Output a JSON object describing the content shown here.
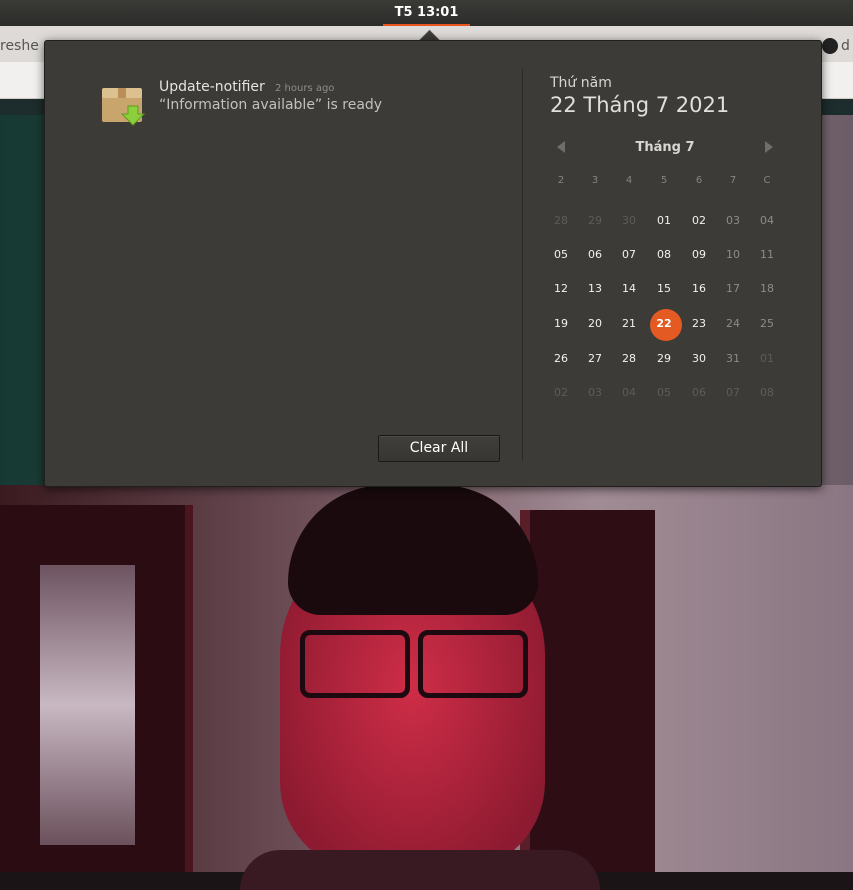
{
  "topbar": {
    "clock": "T5 13:01"
  },
  "browser": {
    "left_tab_text": "reshe",
    "right_tab_text": "d"
  },
  "notifications": [
    {
      "app": "Update-notifier",
      "time": "2 hours ago",
      "body": "“Information available” is ready",
      "icon": "package-download-icon"
    }
  ],
  "clear_all_label": "Clear All",
  "calendar": {
    "weekday": "Thứ năm",
    "full_date": "22 Tháng 7 2021",
    "month_label": "Tháng 7",
    "weekday_headers": [
      "2",
      "3",
      "4",
      "5",
      "6",
      "7",
      "C"
    ],
    "today": "22",
    "accent_color": "#e35a22",
    "weeks": [
      [
        [
          "28",
          "out"
        ],
        [
          "29",
          "out"
        ],
        [
          "30",
          "out"
        ],
        [
          "01",
          "in"
        ],
        [
          "02",
          "in"
        ],
        [
          "03",
          "weekend"
        ],
        [
          "04",
          "weekend"
        ]
      ],
      [
        [
          "05",
          "in"
        ],
        [
          "06",
          "in"
        ],
        [
          "07",
          "in"
        ],
        [
          "08",
          "in"
        ],
        [
          "09",
          "in"
        ],
        [
          "10",
          "weekend"
        ],
        [
          "11",
          "weekend"
        ]
      ],
      [
        [
          "12",
          "in"
        ],
        [
          "13",
          "in"
        ],
        [
          "14",
          "in"
        ],
        [
          "15",
          "in"
        ],
        [
          "16",
          "in"
        ],
        [
          "17",
          "weekend"
        ],
        [
          "18",
          "weekend"
        ]
      ],
      [
        [
          "19",
          "in"
        ],
        [
          "20",
          "in"
        ],
        [
          "21",
          "in"
        ],
        [
          "22",
          "today"
        ],
        [
          "23",
          "in"
        ],
        [
          "24",
          "weekend"
        ],
        [
          "25",
          "weekend"
        ]
      ],
      [
        [
          "26",
          "in"
        ],
        [
          "27",
          "in"
        ],
        [
          "28",
          "in"
        ],
        [
          "29",
          "in"
        ],
        [
          "30",
          "in"
        ],
        [
          "31",
          "weekend"
        ],
        [
          "01",
          "out"
        ]
      ],
      [
        [
          "02",
          "out"
        ],
        [
          "03",
          "out"
        ],
        [
          "04",
          "out"
        ],
        [
          "05",
          "out"
        ],
        [
          "06",
          "out"
        ],
        [
          "07",
          "out"
        ],
        [
          "08",
          "out"
        ]
      ]
    ]
  }
}
